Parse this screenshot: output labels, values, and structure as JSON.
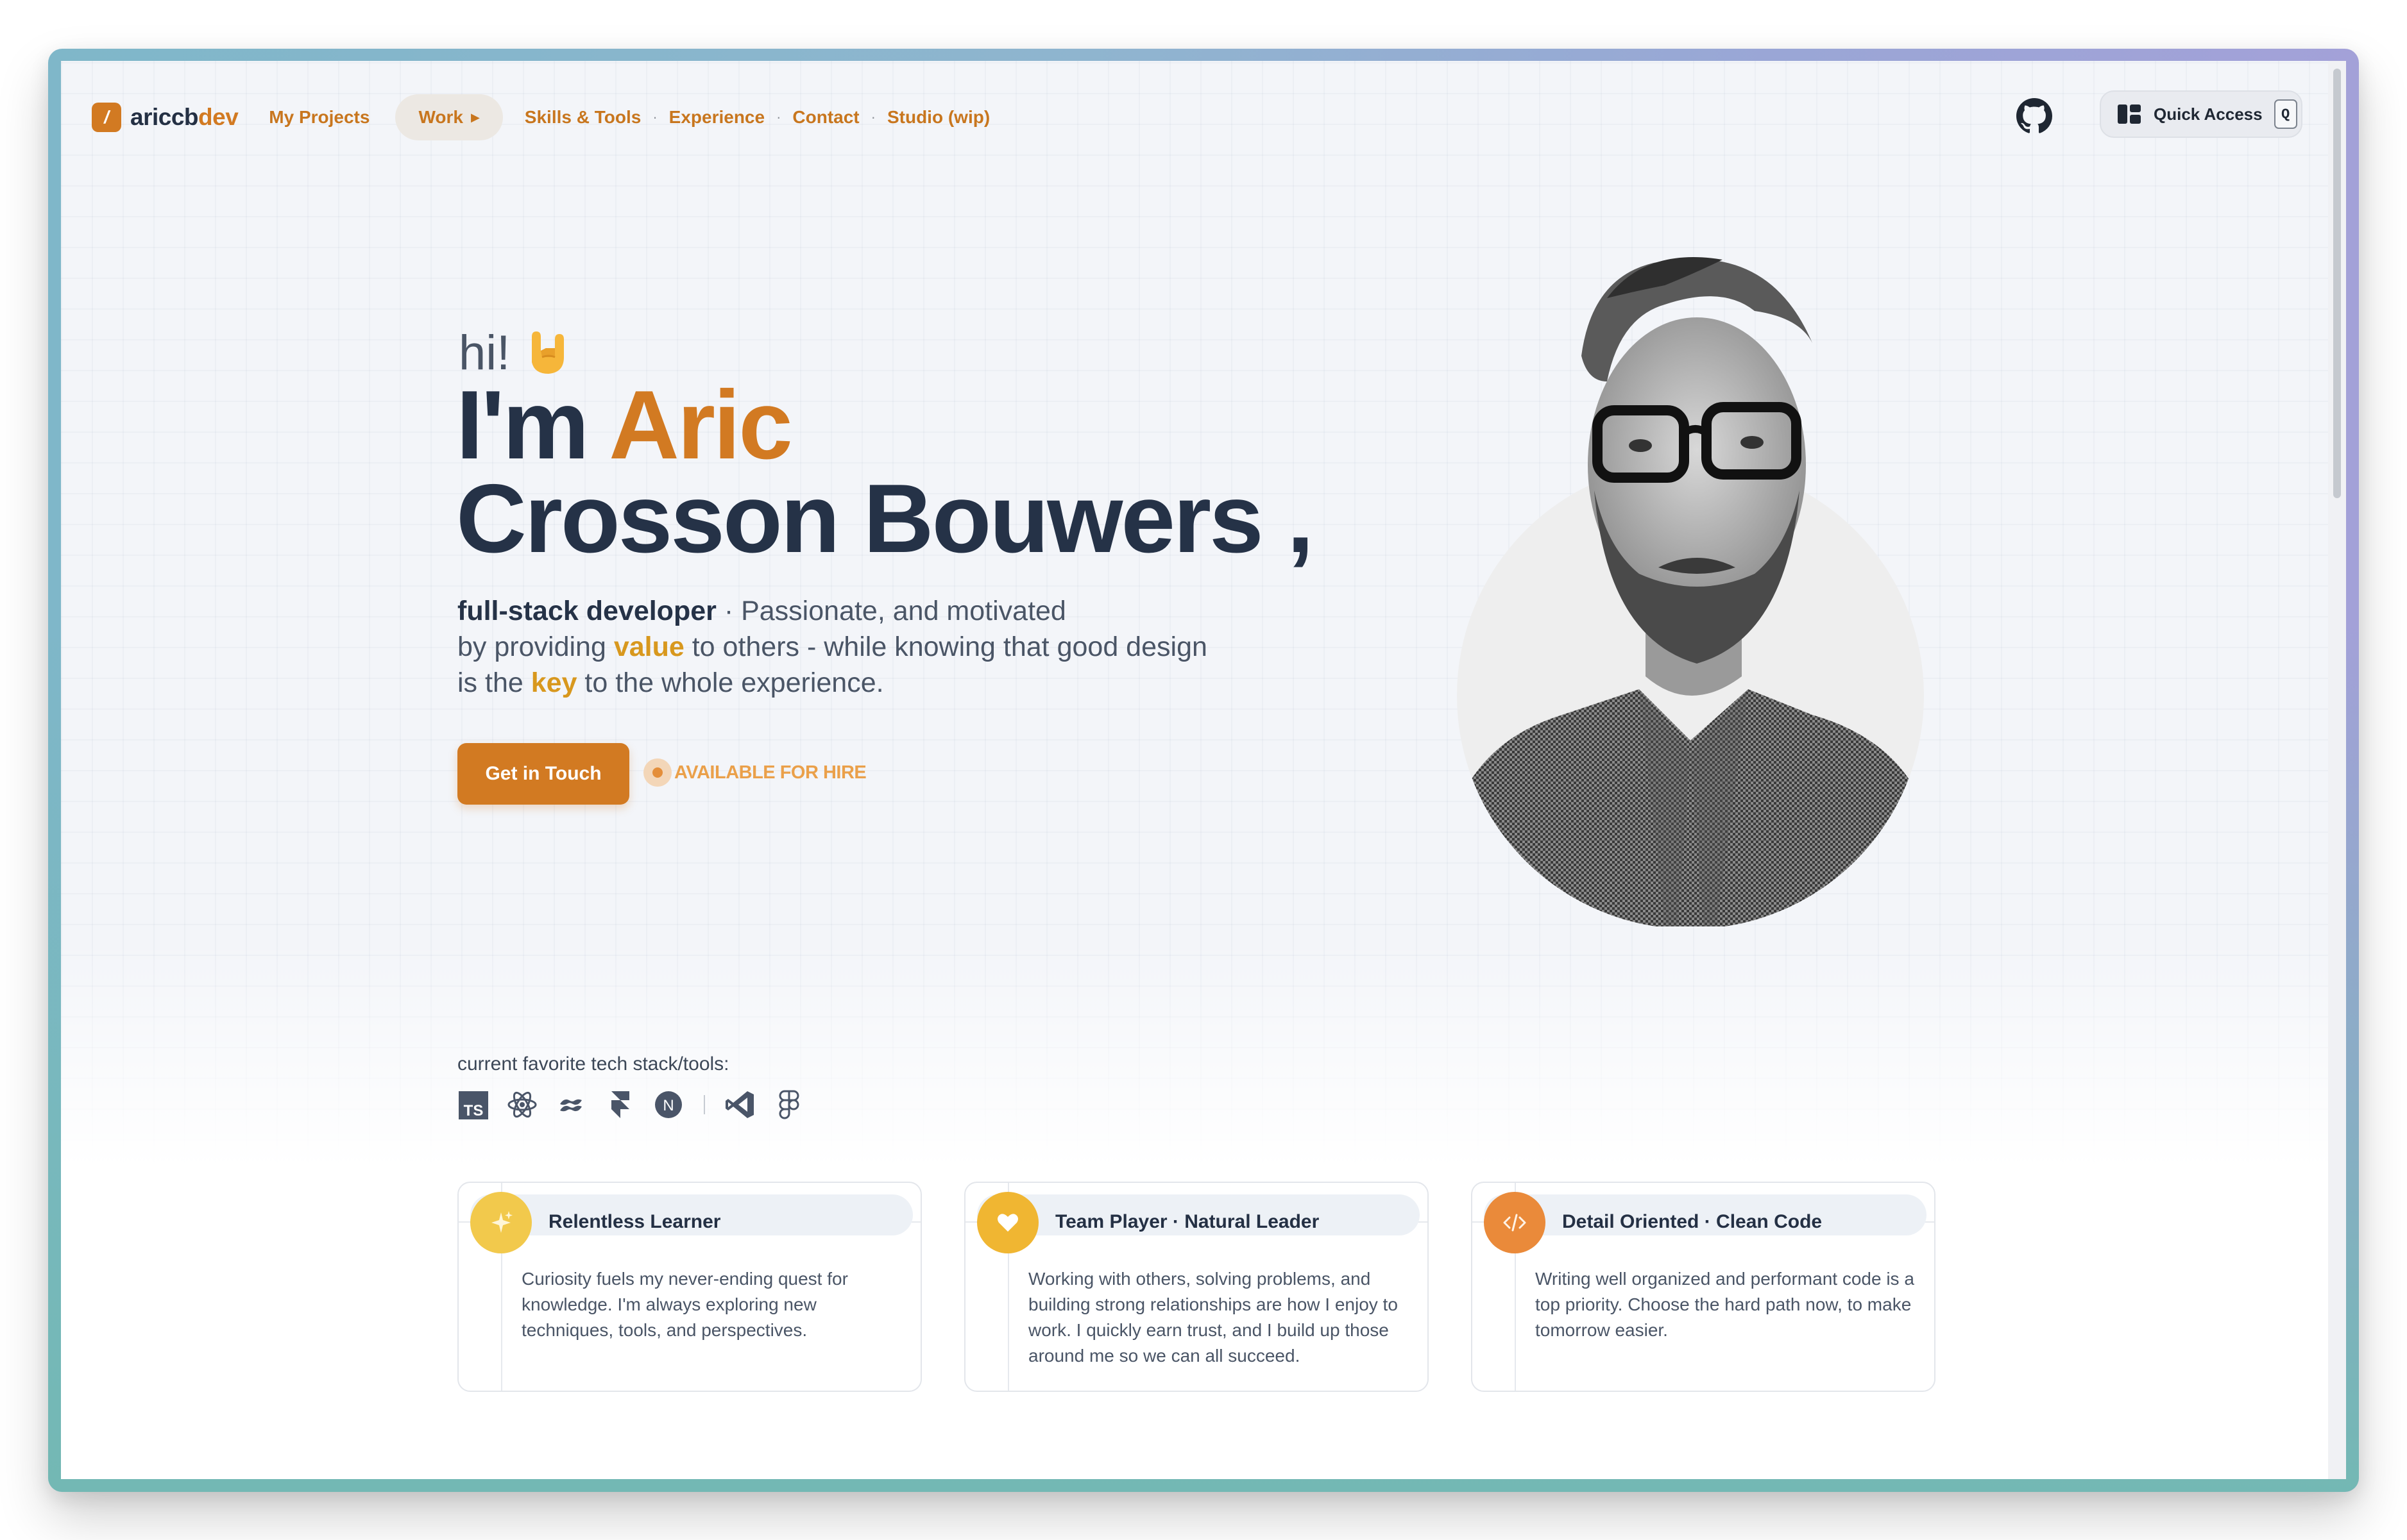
{
  "nav": {
    "logo_mark": "/",
    "logo_text_main": "ariccb",
    "logo_text_accent": "dev",
    "my_projects": "My Projects",
    "work": "Work",
    "skills": "Skills & Tools",
    "experience": "Experience",
    "contact": "Contact",
    "studio": "Studio (wip)",
    "separator": "·",
    "quick_access_label": "Quick Access",
    "quick_access_key": "Q"
  },
  "hero": {
    "greeting": "hi!",
    "name_prefix": "I'm ",
    "first_name": "Aric",
    "last_name": "Crosson Bouwers ,",
    "role": "full-stack developer",
    "bio_1": " · Passionate, and motivated",
    "bio_2": "by providing ",
    "bio_value": "value",
    "bio_3": " to others - while knowing that good design",
    "bio_4": "is the ",
    "bio_key": "key",
    "bio_5": " to the whole experience.",
    "cta": "Get in Touch",
    "availability": "AVAILABLE FOR HIRE"
  },
  "tech": {
    "label": "current favorite tech stack/tools:",
    "icons": [
      "typescript-icon",
      "react-icon",
      "tailwind-icon",
      "framer-icon",
      "nextjs-icon",
      "vscode-icon",
      "figma-icon"
    ]
  },
  "cards": [
    {
      "title": "Relentless Learner",
      "body": "Curiosity fuels my never-ending quest for knowledge. I'm always exploring new techniques, tools, and perspectives.",
      "icon": "sparkles-icon",
      "color": "#f2c94c"
    },
    {
      "title": "Team Player · Natural Leader",
      "body": "Working with others, solving problems, and building strong relationships are how I enjoy to work. I quickly earn trust, and I build up those around me so we can all succeed.",
      "icon": "heart-icon",
      "color": "#f0b632"
    },
    {
      "title": "Detail Oriented · Clean Code",
      "body": "Writing well organized and performant code is a top priority. Choose the hard path now, to make tomorrow easier.",
      "icon": "code-icon",
      "color": "#ea8a3a"
    }
  ],
  "colors": {
    "accent": "#d27a22",
    "heading": "#253247",
    "highlight": "#d8981e"
  }
}
